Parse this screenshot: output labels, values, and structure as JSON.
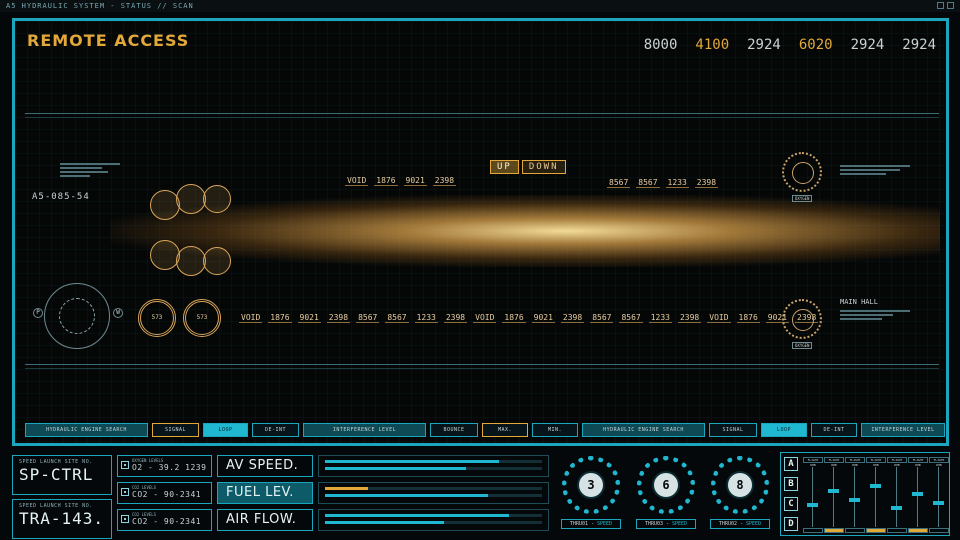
{
  "titlebar": {
    "text": "A5 HYDRAULIC SYSTEM - STATUS // SCAN"
  },
  "header": {
    "title": "REMOTE ACCESS",
    "numbers": [
      {
        "value": "8000",
        "accent": false
      },
      {
        "value": "4100",
        "accent": true
      },
      {
        "value": "2924",
        "accent": false
      },
      {
        "value": "6020",
        "accent": true
      },
      {
        "value": "2924",
        "accent": false
      },
      {
        "value": "2924",
        "accent": false
      }
    ]
  },
  "ship": {
    "id": "A5-085-54",
    "main_hall": "MAIN HALL",
    "oxygen_label": "OXYGEN",
    "updown": [
      "UP",
      "DOWN"
    ],
    "top_readout": [
      "VOID",
      "1876",
      "9021",
      "2398"
    ],
    "right_readout": [
      "8567",
      "8567",
      "1233",
      "2398"
    ],
    "lower_readout": [
      "VOID",
      "1876",
      "9021",
      "2398",
      "8567",
      "8567",
      "1233",
      "2398",
      "VOID",
      "1876",
      "9021",
      "2398",
      "8567",
      "8567",
      "1233",
      "2398",
      "VOID",
      "1876",
      "9021",
      "2398"
    ],
    "dials": [
      "573",
      "573"
    ],
    "compass_marks": [
      "P",
      "W"
    ]
  },
  "tabs": [
    {
      "label": "HYDRAULIC ENGINE SEARCH",
      "style": "teal"
    },
    {
      "label": "SIGNAL",
      "style": "amber"
    },
    {
      "label": "LOOP",
      "style": "cyan"
    },
    {
      "label": "DE-INT",
      "style": "normal"
    },
    {
      "label": "INTERFERENCE LEVEL",
      "style": "teal"
    },
    {
      "label": "BOUNCE",
      "style": "normal"
    },
    {
      "label": "MAX.",
      "style": "amber"
    },
    {
      "label": "MIN.",
      "style": "normal"
    },
    {
      "label": "HYDRAULIC ENGINE SEARCH",
      "style": "teal"
    },
    {
      "label": "SIGNAL",
      "style": "normal"
    },
    {
      "label": "LOOP",
      "style": "cyan"
    },
    {
      "label": "DE-INT",
      "style": "normal"
    },
    {
      "label": "INTERFERENCE LEVEL",
      "style": "teal"
    }
  ],
  "sites": [
    {
      "label": "SPEED LAUNCH SITE NO.",
      "value": "SP-CTRL"
    },
    {
      "label": "SPEED LAUNCH SITE NO.",
      "value": "TRA-143."
    }
  ],
  "levels": [
    {
      "label": "OXYGEN LEVELS",
      "value": "O2 - 39.2 1239"
    },
    {
      "label": "CO2 LEVELS",
      "value": "CO2 - 90-2341"
    },
    {
      "label": "CO2 LEVELS",
      "value": "CO2 - 90-2341"
    }
  ],
  "metrics": [
    {
      "label": "AV SPEED.",
      "active": false,
      "bars": [
        0.8,
        0.65
      ],
      "accent": [
        false,
        false
      ]
    },
    {
      "label": "FUEL LEV.",
      "active": true,
      "bars": [
        0.2,
        0.75
      ],
      "accent": [
        true,
        false
      ]
    },
    {
      "label": "AIR FLOW.",
      "active": false,
      "bars": [
        0.85,
        0.55
      ],
      "accent": [
        false,
        false
      ]
    }
  ],
  "thrusters": [
    {
      "number": "3",
      "name": "THRU01",
      "suffix": "SPEED"
    },
    {
      "number": "6",
      "name": "THRU03",
      "suffix": "SPEED"
    },
    {
      "number": "8",
      "name": "THRU02",
      "suffix": "SPEED"
    }
  ],
  "mixer": {
    "letters": [
      "A",
      "B",
      "C",
      "D"
    ],
    "channels": [
      {
        "label": "FLIGHT RHB",
        "level": 0.35,
        "on": false
      },
      {
        "label": "FLIGHT RHB",
        "level": 0.6,
        "on": true
      },
      {
        "label": "FLIGHT RHB",
        "level": 0.45,
        "on": false
      },
      {
        "label": "FLIGHT RHB",
        "level": 0.7,
        "on": true
      },
      {
        "label": "FLIGHT RHB",
        "level": 0.3,
        "on": false
      },
      {
        "label": "FLIGHT RHB",
        "level": 0.55,
        "on": true
      },
      {
        "label": "FLIGHT RHB",
        "level": 0.4,
        "on": false
      }
    ]
  }
}
